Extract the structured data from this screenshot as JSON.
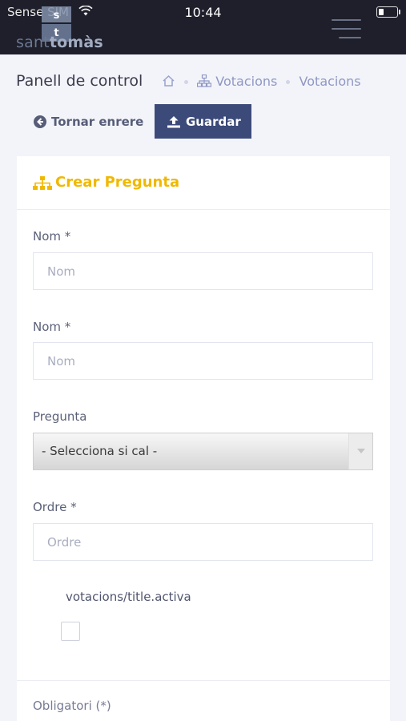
{
  "status": {
    "carrier": "Sense SIM",
    "time": "10:44"
  },
  "logo": {
    "text_a": "sant",
    "text_b": "tomàs",
    "letter_top": "s",
    "letter_bottom": "t"
  },
  "header": {
    "title": "Panell de control"
  },
  "breadcrumb": {
    "items": [
      "Votacions",
      "Votacions"
    ]
  },
  "toolbar": {
    "back_label": "Tornar enrere",
    "save_label": "Guardar"
  },
  "card": {
    "title": "Crear Pregunta"
  },
  "form": {
    "field1_label": "Nom *",
    "field1_placeholder": "Nom",
    "field2_label": "Nom *",
    "field2_placeholder": "Nom",
    "question_label": "Pregunta",
    "question_value": "- Selecciona si cal -",
    "order_label": "Ordre *",
    "order_placeholder": "Ordre",
    "active_label": "votacions/title.activa",
    "mandatory_label": "Obligatori (*)"
  },
  "colors": {
    "accent": "#f0b800",
    "primary": "#3c4a7a",
    "header_bg": "#1e1f2a"
  }
}
